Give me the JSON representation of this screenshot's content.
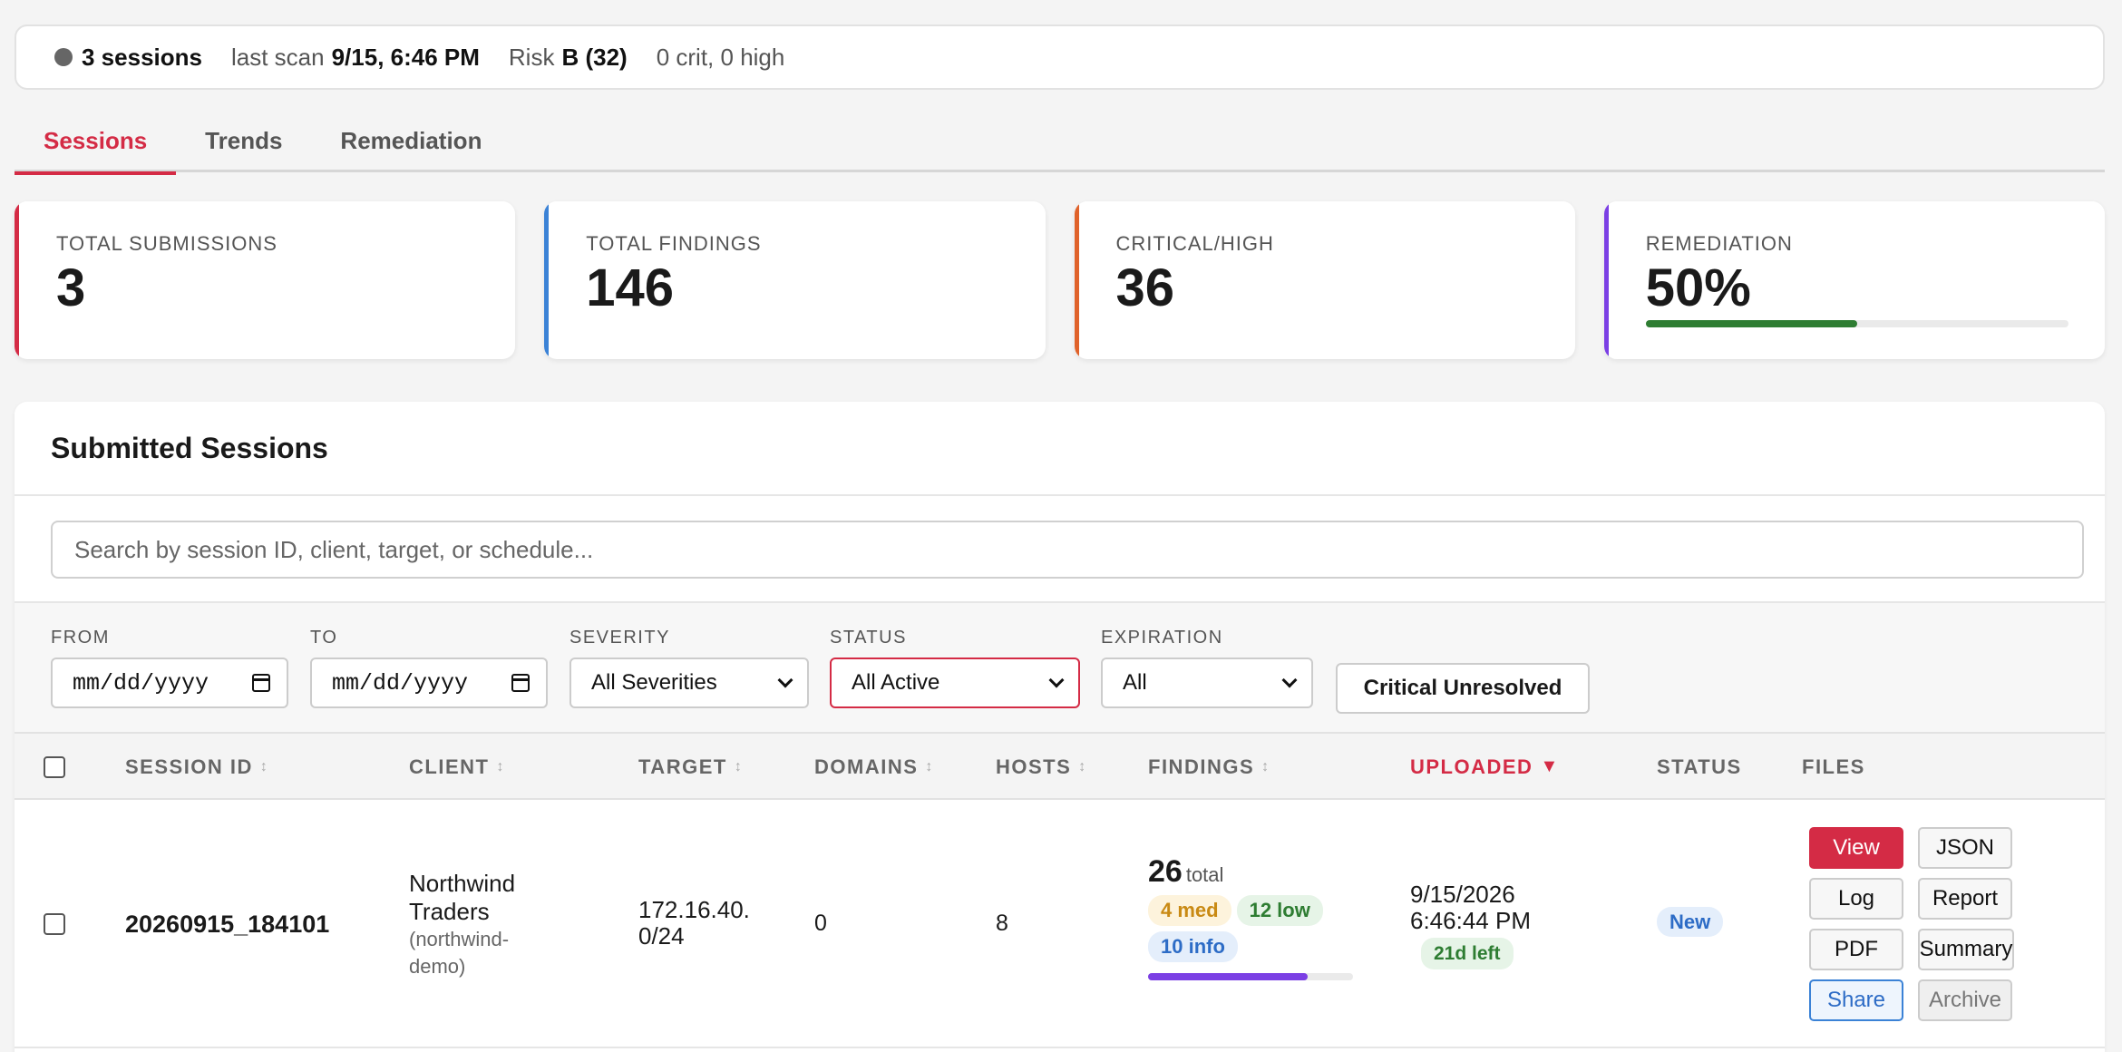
{
  "statusbar": {
    "sessions": "3 sessions",
    "last_scan_label": "last scan",
    "last_scan_value": "9/15, 6:46 PM",
    "risk_label": "Risk",
    "risk_value": "B (32)",
    "crit_high": "0 crit, 0 high"
  },
  "tabs": [
    {
      "label": "Sessions",
      "active": true
    },
    {
      "label": "Trends",
      "active": false
    },
    {
      "label": "Remediation",
      "active": false
    }
  ],
  "stats": [
    {
      "label": "Total Submissions",
      "value": "3",
      "accent": "#d42b45"
    },
    {
      "label": "Total Findings",
      "value": "146",
      "accent": "#3b82d6"
    },
    {
      "label": "Critical/High",
      "value": "36",
      "accent": "#e0622a"
    },
    {
      "label": "Remediation",
      "value": "50%",
      "accent": "#7b3fe4",
      "progress": 0.5,
      "progress_color": "#2e7d32"
    }
  ],
  "panel": {
    "title": "Submitted Sessions",
    "search_placeholder": "Search by session ID, client, target, or schedule..."
  },
  "filters": {
    "from_label": "From",
    "from_value": "mm/dd/yyyy",
    "to_label": "To",
    "to_value": "mm/dd/yyyy",
    "severity_label": "Severity",
    "severity_value": "All Severities",
    "status_label": "Status",
    "status_value": "All Active",
    "expiration_label": "Expiration",
    "expiration_value": "All",
    "critical_button": "Critical Unresolved"
  },
  "table": {
    "headers": {
      "session_id": "Session ID",
      "client": "Client",
      "target": "Target",
      "domains": "Domains",
      "hosts": "Hosts",
      "findings": "Findings",
      "uploaded": "Uploaded",
      "status": "Status",
      "files": "Files"
    },
    "sort_glyph": "↕",
    "sort_active_glyph": "▼",
    "rows": [
      {
        "session_id": "20260915_184101",
        "client_line1": "Northwind",
        "client_line2": "Traders",
        "client_slug_line1": "(northwind-",
        "client_slug_line2": "demo)",
        "target_line1": "172.16.40.",
        "target_line2": "0/24",
        "domains": "0",
        "hosts": "8",
        "findings_total": "26",
        "findings_total_label": "total",
        "med": "4 med",
        "low": "12 low",
        "info": "10 info",
        "findings_progress": 0.78,
        "uploaded_date": "9/15/2026",
        "uploaded_time": "6:46:44 PM",
        "time_left": "21d left",
        "status": "New",
        "files": {
          "view": "View",
          "json": "JSON",
          "log": "Log",
          "report": "Report",
          "pdf": "PDF",
          "summary": "Summary",
          "share": "Share",
          "archive": "Archive"
        }
      }
    ]
  }
}
